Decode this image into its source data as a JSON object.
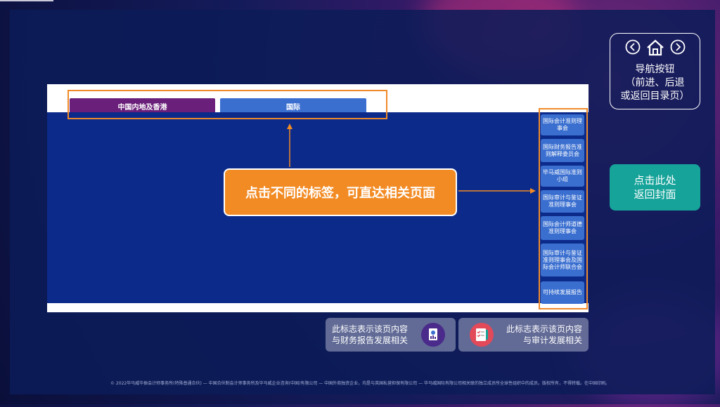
{
  "tabs": {
    "hk_label": "中国内地及香港",
    "intl_label": "国际"
  },
  "callout": {
    "text": "点击不同的标签，可直达相关页面"
  },
  "orgs": [
    "国际会计准则理事会",
    "国际财务报告准则解释委员会",
    "毕马威国际准则小组",
    "国际审计与鉴证准则理事会",
    "国际会计师道德准则理事会",
    "国际审计与鉴证准则理事会及国际会计师联合会",
    "可持续发展报告"
  ],
  "nav": {
    "line1": "导航按钮",
    "line2": "（前进、后退",
    "line3": "或返回目录页）"
  },
  "cover": {
    "line1": "点击此处",
    "line2": "返回封面"
  },
  "legend": {
    "fin_line1": "此标志表示该页内容",
    "fin_line2": "与财务报告发展相关",
    "audit_line1": "此标志表示该页内容",
    "audit_line2": "与审计发展相关"
  },
  "footer": "© 2022毕马威华振会计师事务所(特殊普通合伙) — 中国合伙制会计师事务所及毕马威企业咨询(中国)有限公司 — 中国外商独资企业，均是与英国私营担保有限公司 — 毕马威国际有限公司相关联的独立成员所全球性组织中的成员。版权所有，不得转载。在中国印刷。",
  "colors": {
    "accent_orange": "#f28b24",
    "teal": "#16a39a",
    "tab_purple": "#6a1f7a",
    "tab_blue": "#3a6fd0"
  }
}
